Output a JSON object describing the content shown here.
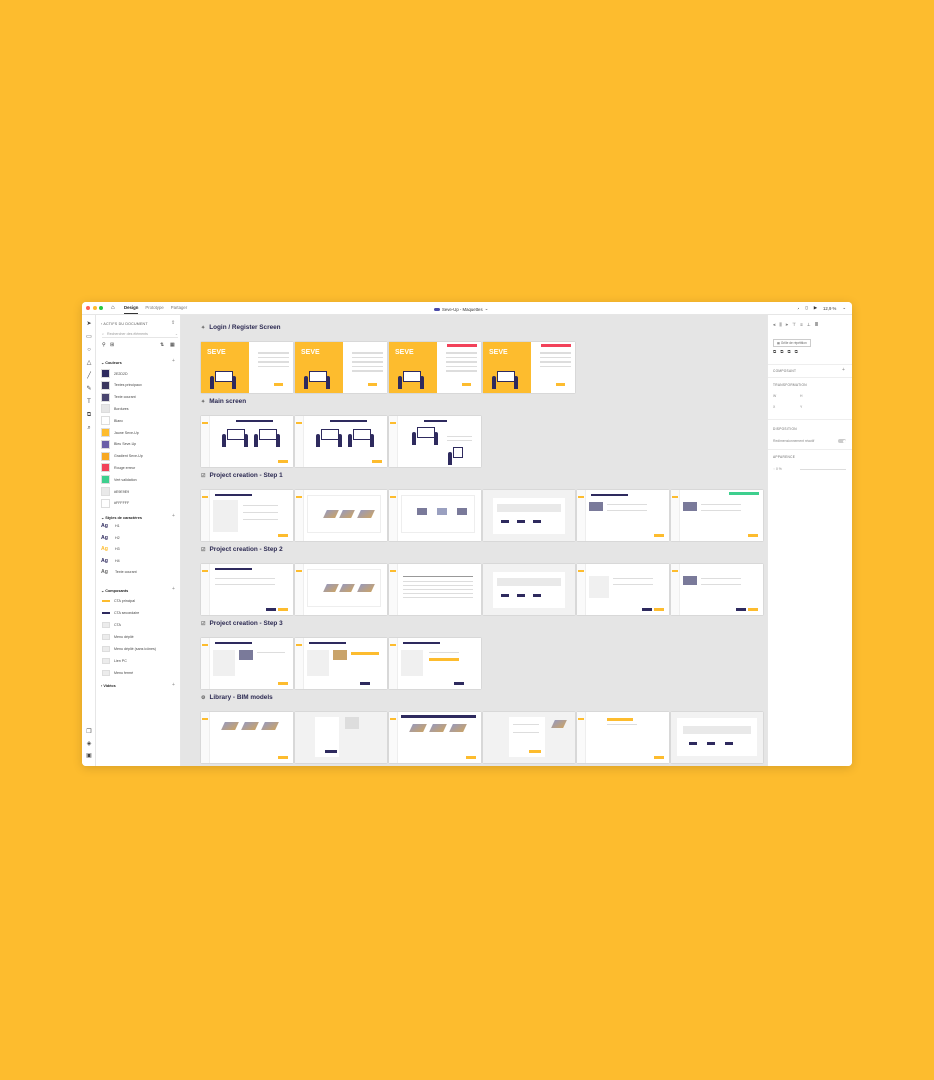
{
  "colors": {
    "background": "#FDBC2E",
    "brand_yellow": "#FDBC2E",
    "navy": "#2E2A5E",
    "pink": "#F2425A",
    "green": "#3ECF8E"
  },
  "titlebar": {
    "tabs": [
      "Design",
      "Prototype",
      "Partager"
    ],
    "active_tab": "Design",
    "doc_title": "Seve-Up - Maquettes",
    "zoom": "12,9 %"
  },
  "left_panel": {
    "header": "ACTIFS DU DOCUMENT",
    "search_placeholder": "Rechercher des éléments",
    "colors_title": "Couleurs",
    "colors": [
      {
        "label": "2E2D2D",
        "hex": "#2E2A5E"
      },
      {
        "label": "Textes principaux",
        "hex": "#3A365E"
      },
      {
        "label": "Texte courant",
        "hex": "#4A4670"
      },
      {
        "label": "Bordures",
        "hex": "#E6E6E6"
      },
      {
        "label": "Blanc",
        "hex": "#FFFFFF"
      },
      {
        "label": "Jaune Seve-Up",
        "hex": "#FDBC2E"
      },
      {
        "label": "Bleu Seve-Up",
        "hex": "#6A5FA8"
      },
      {
        "label": "Gradient Seve-Up",
        "hex": "#F7A823"
      },
      {
        "label": "Rouge erreur",
        "hex": "#F2425A"
      },
      {
        "label": "Vert validation",
        "hex": "#3ECF8E"
      },
      {
        "label": "#E9E9E9",
        "hex": "#E9E9E9"
      },
      {
        "label": "#FFFFFF",
        "hex": "#FFFFFF"
      }
    ],
    "char_styles_title": "Styles de caractères",
    "char_styles": [
      {
        "glyph": "Ag",
        "label": "H1",
        "color": "#2E2A5E"
      },
      {
        "glyph": "Ag",
        "label": "H2",
        "color": "#2E2A5E"
      },
      {
        "glyph": "Ag",
        "label": "H3",
        "color": "#FDBC2E"
      },
      {
        "glyph": "Ag",
        "label": "H4",
        "color": "#2E2A5E"
      },
      {
        "glyph": "Ag",
        "label": "Texte courant",
        "color": "#666666"
      }
    ],
    "components_title": "Composants",
    "components": [
      "CTA principal",
      "CTA secondaire",
      "CTA",
      "Menu déplié",
      "Menu déplié (sans icônes)",
      "Lien PC",
      "Menu fermé"
    ],
    "videos_title": "Vidéos"
  },
  "canvas": {
    "sections": [
      {
        "title": "Login / Register Screen",
        "icon": "pin-icon"
      },
      {
        "title": "Main screen",
        "icon": "pin-icon"
      },
      {
        "title": "Project creation - Step 1",
        "icon": "check-icon"
      },
      {
        "title": "Project creation - Step 2",
        "icon": "check-icon"
      },
      {
        "title": "Project creation - Step 3",
        "icon": "check-icon"
      },
      {
        "title": "Library - BIM models",
        "icon": "gear-icon"
      }
    ],
    "brand_mark": "SEVE"
  },
  "right_panel": {
    "repeat_grid": "Grille de répétition",
    "component_section": "COMPOSANT",
    "transform_section": "TRANSFORMATION",
    "fields": {
      "w": "W",
      "h": "H",
      "x": "X",
      "y": "Y"
    },
    "responsive_section": "DISPOSITION",
    "responsive_label": "Redimensionnement réactif",
    "appearance_section": "APPARENCE",
    "opacity": "0 %"
  }
}
